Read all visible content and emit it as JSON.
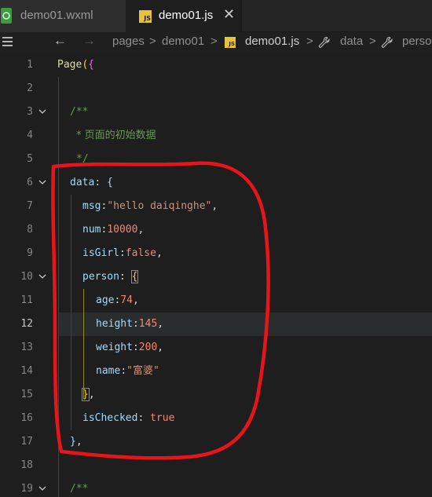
{
  "tabs": [
    {
      "label": "demo01.wxml",
      "active": false,
      "icon": "wechat-file-icon"
    },
    {
      "label": "demo01.js",
      "active": true,
      "icon": "js-file-icon",
      "close": "✕"
    }
  ],
  "breadcrumb": {
    "menu_icon": "hamburger-icon",
    "back": "←",
    "forward": "→",
    "items": [
      "pages",
      "demo01",
      "demo01.js",
      "data",
      "perso"
    ],
    "separator": ">",
    "js_badge": "JS"
  },
  "editor": {
    "current_line": 12,
    "line_numbers": [
      "1",
      "2",
      "3",
      "4",
      "5",
      "6",
      "7",
      "8",
      "9",
      "10",
      "11",
      "12",
      "13",
      "14",
      "15",
      "16",
      "17",
      "18",
      "19"
    ],
    "lines": {
      "l1": {
        "fn": "Page",
        "paren": "(",
        "brace": "{"
      },
      "l3": {
        "text": "/**"
      },
      "l4": {
        "text": "* 页面的初始数据"
      },
      "l5": {
        "text": "*/"
      },
      "l6": {
        "key": "data",
        "colon": ": ",
        "brace": "{"
      },
      "l7": {
        "key": "msg",
        "colon": ":",
        "value": "\"hello daiqinghe\"",
        "comma": ","
      },
      "l8": {
        "key": "num",
        "colon": ":",
        "value": "10000",
        "comma": ","
      },
      "l9": {
        "key": "isGirl",
        "colon": ":",
        "value": "false",
        "comma": ","
      },
      "l10": {
        "key": "person",
        "colon": ": ",
        "brace": "{"
      },
      "l11": {
        "key": "age",
        "colon": ":",
        "value": "74",
        "comma": ","
      },
      "l12": {
        "key": "height",
        "colon": ":",
        "value": "145",
        "comma": ","
      },
      "l13": {
        "key": "weight",
        "colon": ":",
        "value": "200",
        "comma": ","
      },
      "l14": {
        "key": "name",
        "colon": ":",
        "value": "\"富婆\""
      },
      "l15": {
        "brace": "}",
        "comma": ","
      },
      "l16": {
        "key": "isChecked",
        "colon": ": ",
        "value": "true"
      },
      "l17": {
        "brace": "}",
        "comma": ","
      },
      "l19": {
        "text": "/**"
      }
    }
  },
  "colors": {
    "annotation": "#e8141c",
    "keyword_prop": "#9cdcfe",
    "string": "#ce9178",
    "number": "#f48771",
    "comment": "#6a9955",
    "brace_gold": "#ffd700"
  }
}
